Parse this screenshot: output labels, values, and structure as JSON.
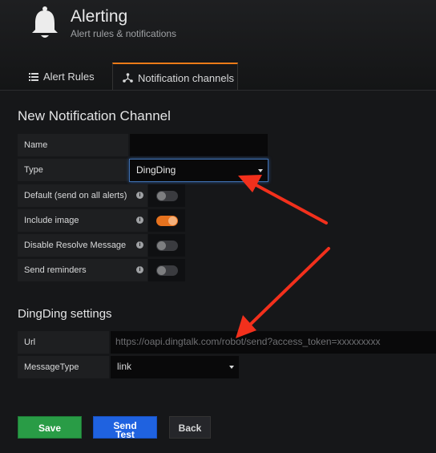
{
  "header": {
    "title": "Alerting",
    "subtitle": "Alert rules & notifications"
  },
  "tabs": [
    {
      "label": "Alert Rules",
      "icon": "list-icon",
      "active": false
    },
    {
      "label": "Notification channels",
      "icon": "share-icon",
      "active": true
    }
  ],
  "form": {
    "title": "New Notification Channel",
    "name_label": "Name",
    "name_value": "",
    "type_label": "Type",
    "type_value": "DingDing",
    "default_label": "Default (send on all alerts)",
    "default_on": false,
    "include_image_label": "Include image",
    "include_image_on": true,
    "disable_resolve_label": "Disable Resolve Message",
    "disable_resolve_on": false,
    "send_reminders_label": "Send reminders",
    "send_reminders_on": false
  },
  "dingding": {
    "title": "DingDing settings",
    "url_label": "Url",
    "url_placeholder": "https://oapi.dingtalk.com/robot/send?access_token=xxxxxxxxx",
    "message_type_label": "MessageType",
    "message_type_value": "link"
  },
  "buttons": {
    "save": "Save",
    "test_line1": "Send",
    "test_line2": "Test",
    "back": "Back"
  },
  "colors": {
    "accent": "#eb7b18",
    "switch_on": "#e6721e",
    "save": "#299c46",
    "test": "#1f62e0",
    "annotation_arrow": "#f2301c"
  }
}
